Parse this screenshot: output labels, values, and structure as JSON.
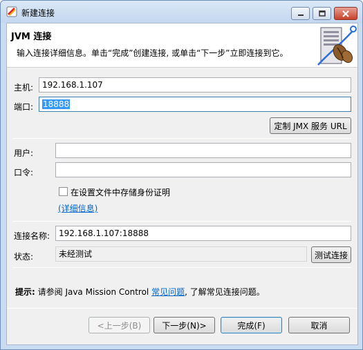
{
  "window": {
    "title": "新建连接"
  },
  "header": {
    "title": "JVM 连接",
    "description": "输入连接详细信息。单击“完成”创建连接, 或单击“下一步”立即连接到它。"
  },
  "form": {
    "host_label": "主机:",
    "host_value": "192.168.1.107",
    "port_label": "端口:",
    "port_value": "18888",
    "jmx_button": "定制 JMX 服务 URL",
    "user_label": "用户:",
    "user_value": "",
    "password_label": "口令:",
    "password_value": "",
    "store_checkbox_label": "在设置文件中存储身份证明",
    "store_checked": false,
    "details_link": "(详细信息)",
    "conn_name_label": "连接名称:",
    "conn_name_value": "192.168.1.107:18888",
    "status_label": "状态:",
    "status_value": "未经测试",
    "test_button": "测试连接"
  },
  "hint": {
    "prefix": "提示:",
    "text_before": " 请参阅 Java Mission Control ",
    "link": "常见问题",
    "text_after": ", 了解常见连接问题。"
  },
  "buttons": {
    "back": "<上一步(B)",
    "next": "下一步(N)>",
    "finish": "完成(F)",
    "cancel": "取消"
  },
  "colors": {
    "selection": "#3399ff",
    "link": "#0066cc",
    "titlebar": "#c3d7ef",
    "close": "#c7412b"
  }
}
